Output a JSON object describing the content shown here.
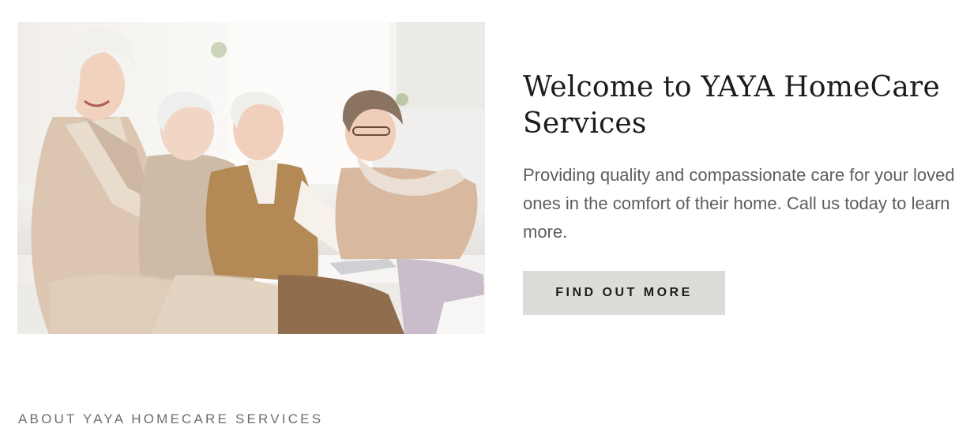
{
  "hero": {
    "image_alt": "Four smiling seniors sitting together on a sofa looking at a laptop",
    "title": "Welcome to YAYA HomeCare Services",
    "description": "Providing quality and compassionate care for your loved ones in the comfort of their home. Call us today to learn more.",
    "cta_label": "FIND OUT MORE"
  },
  "about": {
    "heading": "ABOUT YAYA HOMECARE SERVICES"
  },
  "colors": {
    "background": "#ffffff",
    "title_text": "#1c1c1c",
    "body_text": "#5d5d5d",
    "button_bg": "#dedcd8",
    "label_text": "#6d6d6d"
  }
}
